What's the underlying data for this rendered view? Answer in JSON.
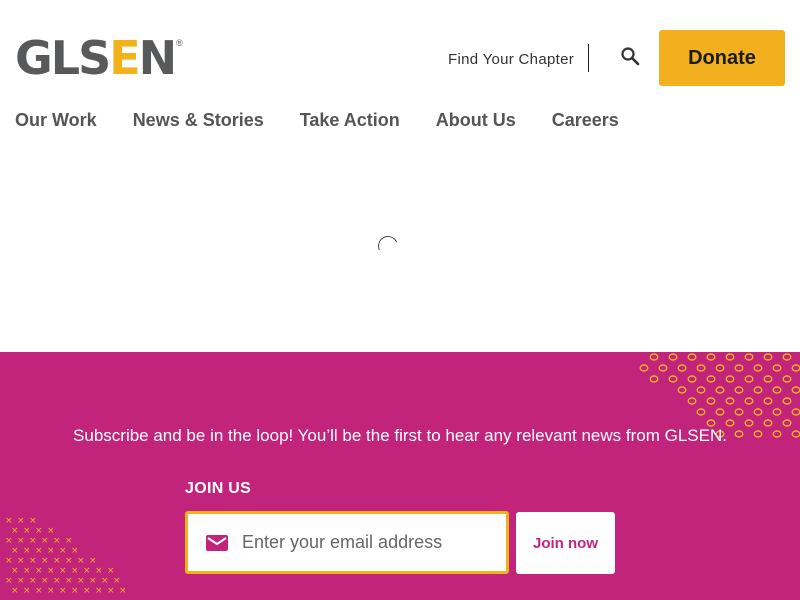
{
  "header": {
    "logo": {
      "letters_gray": "GLS",
      "letter_accent": "E",
      "letter_last": "N",
      "registered": "®"
    },
    "find_chapter": "Find Your Chapter",
    "search_icon": "search-icon",
    "donate_label": "Donate"
  },
  "nav": {
    "items": [
      {
        "label": "Our Work"
      },
      {
        "label": "News & Stories"
      },
      {
        "label": "Take Action"
      },
      {
        "label": "About Us"
      },
      {
        "label": "Careers"
      }
    ]
  },
  "main": {
    "loading_icon": "loading-spinner-icon"
  },
  "footer": {
    "subscribe_text": "Subscribe and be in the loop! You’ll be the first to hear any relevant news from GLSEN.",
    "join_label": "JOIN US",
    "email_placeholder": "Enter your email address",
    "email_icon": "mail-icon",
    "join_button": "Join now"
  },
  "colors": {
    "brand_gray": "#58595b",
    "brand_yellow": "#f2b21b",
    "band_magenta": "#c1247a",
    "donate_bg": "#f2b01e"
  }
}
